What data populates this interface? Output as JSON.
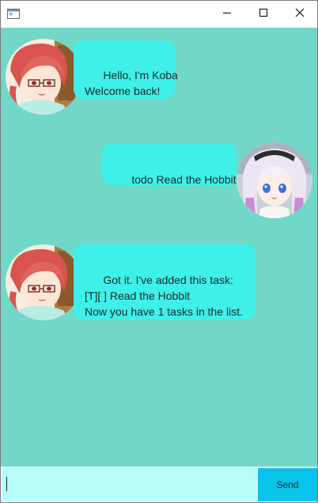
{
  "window": {
    "icon": "app-window-icon",
    "controls": [
      "minimize-icon",
      "maximize-icon",
      "close-icon"
    ]
  },
  "chat": {
    "background": "#71d8c7",
    "bubble_color": "#3ef0e9",
    "messages": [
      {
        "sender": "bot",
        "avatar": "koba-avatar",
        "text": "Hello, I'm Koba\nWelcome back!"
      },
      {
        "sender": "user",
        "avatar": "kanna-avatar",
        "text": "todo Read the Hobbit"
      },
      {
        "sender": "bot",
        "avatar": "koba-avatar",
        "text": "Got it. I've added this task:\n[T][ ] Read the Hobbit\nNow you have 1 tasks in the list."
      }
    ]
  },
  "input": {
    "value": "",
    "background": "#bafcfa"
  },
  "send": {
    "label": "Send",
    "color": "#08c3ea"
  }
}
